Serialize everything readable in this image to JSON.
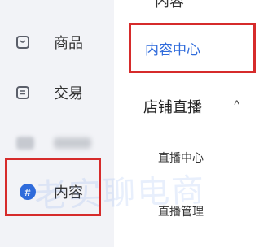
{
  "sidebar": {
    "items": [
      {
        "label": "商品",
        "icon": "shopping-bag-icon"
      },
      {
        "label": "交易",
        "icon": "receipt-icon"
      },
      {
        "label": "",
        "icon": "blurred-icon"
      },
      {
        "label": "内容",
        "icon": "hash-icon",
        "icon_glyph": "#",
        "selected": true
      }
    ]
  },
  "panel": {
    "top_cut_label": "内容",
    "content_center": "内容中心",
    "group": {
      "title": "店铺直播",
      "caret": "^",
      "items": [
        "直播中心",
        "直播管理"
      ]
    }
  },
  "watermark": "老实聊电商",
  "colors": {
    "accent": "#2f6bdb",
    "highlight_border": "#d62b2b",
    "sidebar_bg": "#f2f3f7"
  }
}
